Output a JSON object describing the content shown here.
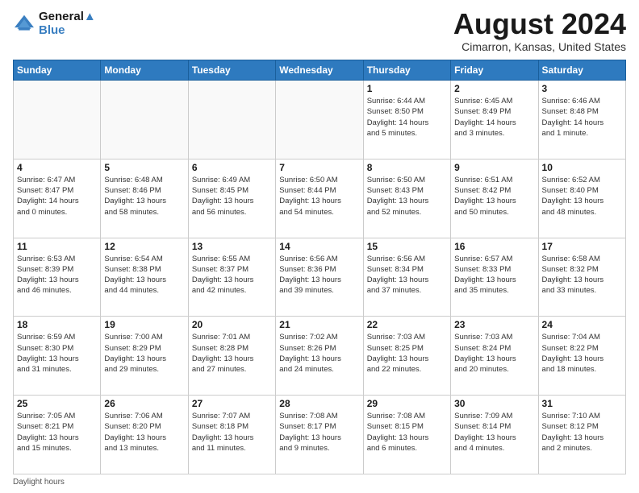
{
  "header": {
    "logo_line1": "General",
    "logo_line2": "Blue",
    "month_title": "August 2024",
    "location": "Cimarron, Kansas, United States"
  },
  "days_of_week": [
    "Sunday",
    "Monday",
    "Tuesday",
    "Wednesday",
    "Thursday",
    "Friday",
    "Saturday"
  ],
  "weeks": [
    [
      {
        "day": "",
        "info": ""
      },
      {
        "day": "",
        "info": ""
      },
      {
        "day": "",
        "info": ""
      },
      {
        "day": "",
        "info": ""
      },
      {
        "day": "1",
        "info": "Sunrise: 6:44 AM\nSunset: 8:50 PM\nDaylight: 14 hours\nand 5 minutes."
      },
      {
        "day": "2",
        "info": "Sunrise: 6:45 AM\nSunset: 8:49 PM\nDaylight: 14 hours\nand 3 minutes."
      },
      {
        "day": "3",
        "info": "Sunrise: 6:46 AM\nSunset: 8:48 PM\nDaylight: 14 hours\nand 1 minute."
      }
    ],
    [
      {
        "day": "4",
        "info": "Sunrise: 6:47 AM\nSunset: 8:47 PM\nDaylight: 14 hours\nand 0 minutes."
      },
      {
        "day": "5",
        "info": "Sunrise: 6:48 AM\nSunset: 8:46 PM\nDaylight: 13 hours\nand 58 minutes."
      },
      {
        "day": "6",
        "info": "Sunrise: 6:49 AM\nSunset: 8:45 PM\nDaylight: 13 hours\nand 56 minutes."
      },
      {
        "day": "7",
        "info": "Sunrise: 6:50 AM\nSunset: 8:44 PM\nDaylight: 13 hours\nand 54 minutes."
      },
      {
        "day": "8",
        "info": "Sunrise: 6:50 AM\nSunset: 8:43 PM\nDaylight: 13 hours\nand 52 minutes."
      },
      {
        "day": "9",
        "info": "Sunrise: 6:51 AM\nSunset: 8:42 PM\nDaylight: 13 hours\nand 50 minutes."
      },
      {
        "day": "10",
        "info": "Sunrise: 6:52 AM\nSunset: 8:40 PM\nDaylight: 13 hours\nand 48 minutes."
      }
    ],
    [
      {
        "day": "11",
        "info": "Sunrise: 6:53 AM\nSunset: 8:39 PM\nDaylight: 13 hours\nand 46 minutes."
      },
      {
        "day": "12",
        "info": "Sunrise: 6:54 AM\nSunset: 8:38 PM\nDaylight: 13 hours\nand 44 minutes."
      },
      {
        "day": "13",
        "info": "Sunrise: 6:55 AM\nSunset: 8:37 PM\nDaylight: 13 hours\nand 42 minutes."
      },
      {
        "day": "14",
        "info": "Sunrise: 6:56 AM\nSunset: 8:36 PM\nDaylight: 13 hours\nand 39 minutes."
      },
      {
        "day": "15",
        "info": "Sunrise: 6:56 AM\nSunset: 8:34 PM\nDaylight: 13 hours\nand 37 minutes."
      },
      {
        "day": "16",
        "info": "Sunrise: 6:57 AM\nSunset: 8:33 PM\nDaylight: 13 hours\nand 35 minutes."
      },
      {
        "day": "17",
        "info": "Sunrise: 6:58 AM\nSunset: 8:32 PM\nDaylight: 13 hours\nand 33 minutes."
      }
    ],
    [
      {
        "day": "18",
        "info": "Sunrise: 6:59 AM\nSunset: 8:30 PM\nDaylight: 13 hours\nand 31 minutes."
      },
      {
        "day": "19",
        "info": "Sunrise: 7:00 AM\nSunset: 8:29 PM\nDaylight: 13 hours\nand 29 minutes."
      },
      {
        "day": "20",
        "info": "Sunrise: 7:01 AM\nSunset: 8:28 PM\nDaylight: 13 hours\nand 27 minutes."
      },
      {
        "day": "21",
        "info": "Sunrise: 7:02 AM\nSunset: 8:26 PM\nDaylight: 13 hours\nand 24 minutes."
      },
      {
        "day": "22",
        "info": "Sunrise: 7:03 AM\nSunset: 8:25 PM\nDaylight: 13 hours\nand 22 minutes."
      },
      {
        "day": "23",
        "info": "Sunrise: 7:03 AM\nSunset: 8:24 PM\nDaylight: 13 hours\nand 20 minutes."
      },
      {
        "day": "24",
        "info": "Sunrise: 7:04 AM\nSunset: 8:22 PM\nDaylight: 13 hours\nand 18 minutes."
      }
    ],
    [
      {
        "day": "25",
        "info": "Sunrise: 7:05 AM\nSunset: 8:21 PM\nDaylight: 13 hours\nand 15 minutes."
      },
      {
        "day": "26",
        "info": "Sunrise: 7:06 AM\nSunset: 8:20 PM\nDaylight: 13 hours\nand 13 minutes."
      },
      {
        "day": "27",
        "info": "Sunrise: 7:07 AM\nSunset: 8:18 PM\nDaylight: 13 hours\nand 11 minutes."
      },
      {
        "day": "28",
        "info": "Sunrise: 7:08 AM\nSunset: 8:17 PM\nDaylight: 13 hours\nand 9 minutes."
      },
      {
        "day": "29",
        "info": "Sunrise: 7:08 AM\nSunset: 8:15 PM\nDaylight: 13 hours\nand 6 minutes."
      },
      {
        "day": "30",
        "info": "Sunrise: 7:09 AM\nSunset: 8:14 PM\nDaylight: 13 hours\nand 4 minutes."
      },
      {
        "day": "31",
        "info": "Sunrise: 7:10 AM\nSunset: 8:12 PM\nDaylight: 13 hours\nand 2 minutes."
      }
    ]
  ],
  "footer": {
    "note": "Daylight hours"
  }
}
